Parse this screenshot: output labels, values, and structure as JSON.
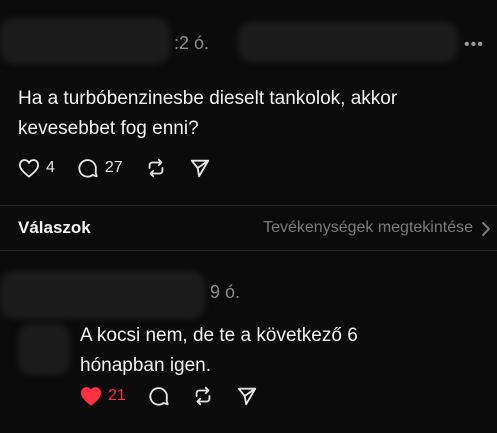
{
  "post": {
    "time": ":2 ó.",
    "more_label": "•••",
    "text_line1": "Ha a turbóbenzinesbe dieselt tankolok, akkor",
    "text_line2": "kevesebbet fog enni?",
    "likes": "4",
    "comments": "27",
    "icons": [
      "heart-icon",
      "comment-icon",
      "repost-icon",
      "share-icon"
    ]
  },
  "replies_header": {
    "title": "Válaszok",
    "activity_link": "Tevékenységek megtekintése"
  },
  "reply": {
    "time": "9 ó.",
    "text_line1": "A kocsi nem, de te a következő 6",
    "text_line2": "hónapban igen.",
    "likes": "21",
    "liked": true,
    "icons": [
      "heart-filled-icon",
      "comment-icon",
      "repost-icon",
      "share-icon"
    ]
  },
  "colors": {
    "background": "#0b0b0b",
    "like_red": "#ff3040",
    "muted": "#8c8c8c"
  }
}
